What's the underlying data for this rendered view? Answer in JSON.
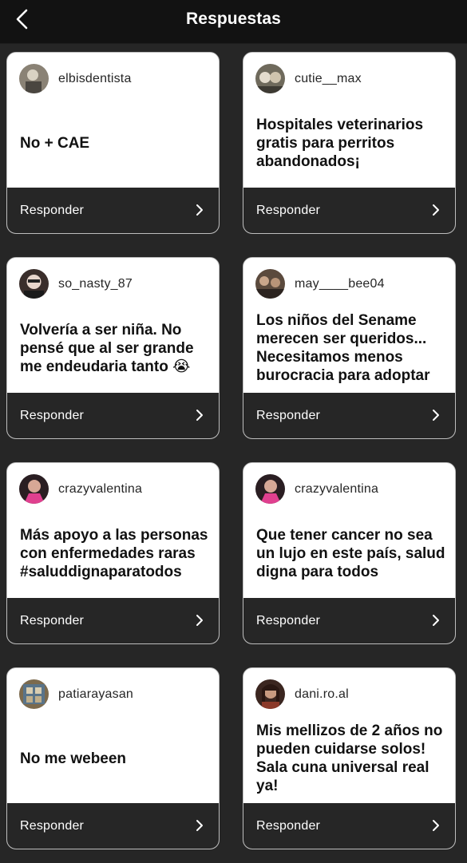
{
  "header": {
    "title": "Respuestas",
    "back_icon": "chevron-left-icon"
  },
  "colors": {
    "background": "#262626",
    "header": "#121212",
    "card": "#ffffff",
    "card_footer": "#262626"
  },
  "cards": [
    {
      "username": "elbisdentista",
      "message": "No + CAE",
      "reply_label": "Responder"
    },
    {
      "username": "cutie__max",
      "message": "Hospitales veterinarios gratis para perritos abandonados¡",
      "reply_label": "Responder"
    },
    {
      "username": "so_nasty_87",
      "message": "Volvería a ser niña. No pensé que al ser grande me endeudaria tanto 😭",
      "reply_label": "Responder"
    },
    {
      "username": "may____bee04",
      "message": "Los niños del Sename merecen ser queridos... Necesitamos menos burocracia para adoptar",
      "reply_label": "Responder"
    },
    {
      "username": "crazyvalentina",
      "message": "Más apoyo a las personas con enfermedades raras #saluddignaparatodos",
      "reply_label": "Responder"
    },
    {
      "username": "crazyvalentina",
      "message": "Que tener cancer no sea un lujo en este país, salud digna para todos",
      "reply_label": "Responder"
    },
    {
      "username": "patiarayasan",
      "message": "No me webeen",
      "reply_label": "Responder"
    },
    {
      "username": "dani.ro.al",
      "message": "Mis mellizos de 2 años no pueden cuidarse solos! Sala cuna universal real ya!",
      "reply_label": "Responder"
    }
  ]
}
